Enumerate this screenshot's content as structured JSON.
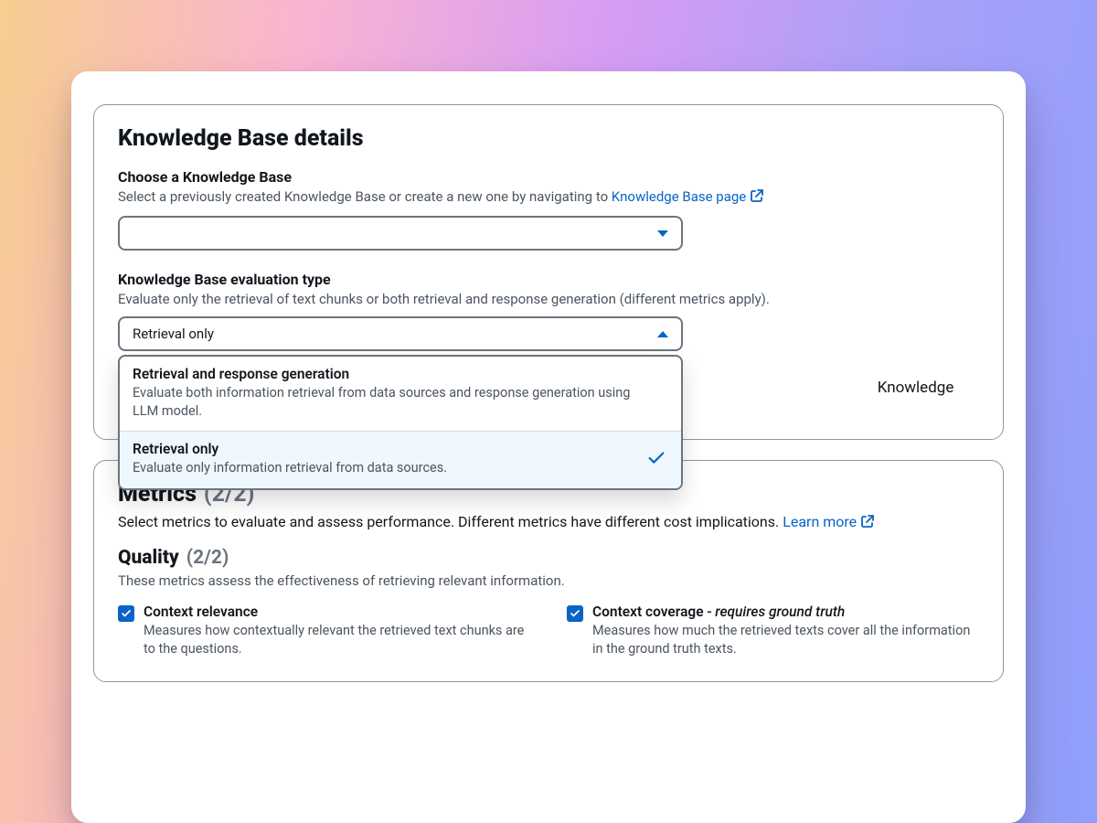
{
  "kb_panel": {
    "title": "Knowledge Base details",
    "choose_label": "Choose a Knowledge Base",
    "choose_desc_prefix": "Select a previously created Knowledge Base or create a new one by navigating to ",
    "choose_link": "Knowledge Base page",
    "kb_select_value": "",
    "eval_type_label": "Knowledge Base evaluation type",
    "eval_type_desc": "Evaluate only the retrieval of text chunks or both retrieval and response generation (different metrics apply).",
    "eval_type_value": "Retrieval only",
    "options": [
      {
        "title": "Retrieval and response generation",
        "desc": "Evaluate both information retrieval from data sources and response generation using LLM model."
      },
      {
        "title": "Retrieval only",
        "desc": "Evaluate only information retrieval from data sources."
      }
    ],
    "behind_text_suffix": "Knowledge Base."
  },
  "metrics_panel": {
    "title": "Metrics",
    "count": "(2/2)",
    "desc_prefix": "Select metrics to evaluate and assess performance. Different metrics have different cost implications. ",
    "learn_more": "Learn more",
    "quality_title": "Quality",
    "quality_count": "(2/2)",
    "quality_desc": "These metrics assess the effectiveness of retrieving relevant information.",
    "metrics": [
      {
        "label": "Context relevance",
        "note": "",
        "desc": "Measures how contextually relevant the retrieved text chunks are to the questions."
      },
      {
        "label": "Context coverage",
        "note": " - requires ground truth",
        "desc": "Measures how much the retrieved texts cover all the information in the ground truth texts."
      }
    ]
  }
}
